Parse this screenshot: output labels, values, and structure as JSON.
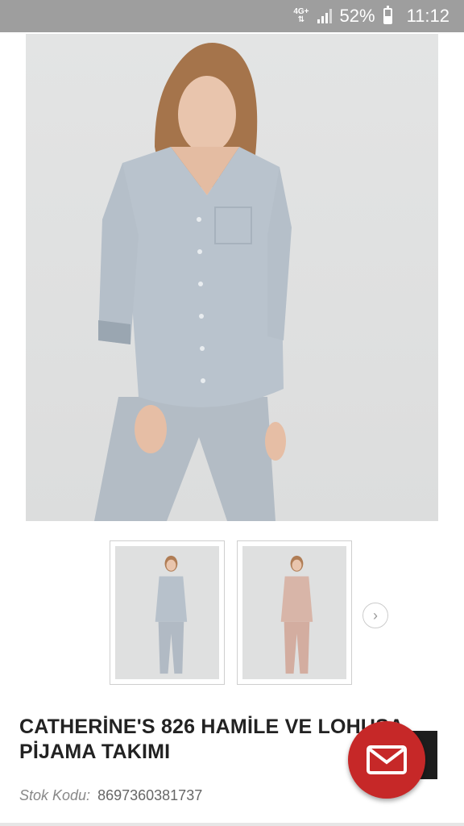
{
  "status_bar": {
    "network": "4G+",
    "battery": "52%",
    "time": "11:12"
  },
  "product": {
    "title": "CATHERİNE'S 826 HAMİLE VE LOHUSA PİJAMA TAKIMI",
    "stock_label": "Stok Kodu:",
    "stock_code": "8697360381737"
  },
  "gallery": {
    "thumbnails": [
      {
        "color": "#b7c1cb"
      },
      {
        "color": "#d8b5a8"
      }
    ],
    "next_icon": "chevron-right-icon"
  },
  "contact": {
    "icon": "mail-icon",
    "color": "#c62828"
  }
}
